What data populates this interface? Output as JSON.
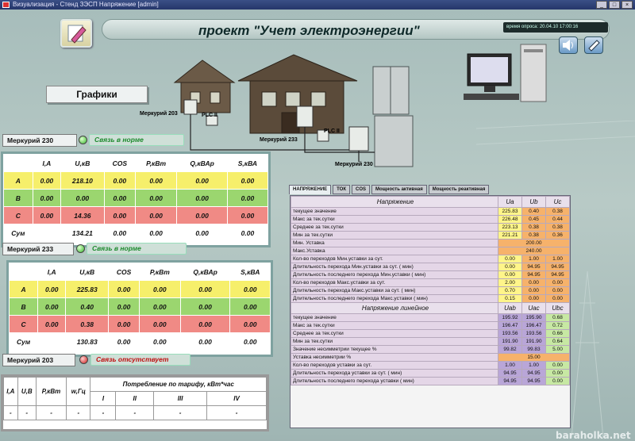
{
  "window": {
    "title": "Визуализация - Стенд ЗЭСП Напряжение [admin]"
  },
  "header": {
    "title": "проект \"Учет электроэнергии\"",
    "poll_time": "время опроса: 20.04.10 17:00:16"
  },
  "nav": {
    "graphs_label": "Графики"
  },
  "scene": {
    "labels": {
      "m203": "Меркурий 203",
      "plc1": "PLC II",
      "m233": "Меркурий 233",
      "plc2": "PLC II",
      "m230": "Меркурий 230"
    }
  },
  "m230": {
    "title": "Меркурий 230",
    "status": "Связь в норме",
    "headers": [
      "",
      "I,A",
      "U,кВ",
      "COS",
      "P,кВт",
      "Q,кВАр",
      "S,кВА"
    ],
    "rows": [
      [
        "A",
        "0.00",
        "218.10",
        "0.00",
        "0.00",
        "0.00",
        "0.00"
      ],
      [
        "B",
        "0.00",
        "0.00",
        "0.00",
        "0.00",
        "0.00",
        "0.00"
      ],
      [
        "C",
        "0.00",
        "14.36",
        "0.00",
        "0.00",
        "0.00",
        "0.00"
      ],
      [
        "Сум",
        "",
        "134.21",
        "0.00",
        "0.00",
        "0.00",
        "0.00"
      ]
    ]
  },
  "m233": {
    "title": "Меркурий 233",
    "status": "Связь в норме",
    "headers": [
      "",
      "I,A",
      "U,кВ",
      "COS",
      "P,кВт",
      "Q,кВАр",
      "S,кВА"
    ],
    "rows": [
      [
        "A",
        "0.00",
        "225.83",
        "0.00",
        "0.00",
        "0.00",
        "0.00"
      ],
      [
        "B",
        "0.00",
        "0.40",
        "0.00",
        "0.00",
        "0.00",
        "0.00"
      ],
      [
        "C",
        "0.00",
        "0.38",
        "0.00",
        "0.00",
        "0.00",
        "0.00"
      ],
      [
        "Сум",
        "",
        "130.83",
        "0.00",
        "0.00",
        "0.00",
        "0.00"
      ]
    ]
  },
  "m203": {
    "title": "Меркурий 203",
    "status": "Связь отсутствует",
    "headers": [
      "I,A",
      "U,B",
      "P,кВт",
      "w,Гц"
    ],
    "consumption_header": "Потребление по тарифу, кВт*час",
    "tariffs": [
      "I",
      "II",
      "III",
      "IV"
    ],
    "values": [
      "-",
      "-",
      "-",
      "-",
      "-",
      "-",
      "-",
      "-"
    ]
  },
  "tabs": [
    "НАПРЯЖЕНИЕ",
    "ТОК",
    "COS",
    "Мощность активная",
    "Мощность реактивная"
  ],
  "voltage": {
    "section1": "Напряжение",
    "cols1": [
      "Ua",
      "Ub",
      "Uc"
    ],
    "rows1": [
      {
        "label": "текущее значение",
        "v": [
          "225.83",
          "0.40",
          "0.38"
        ]
      },
      {
        "label": "Макс за тек.сутки",
        "v": [
          "226.48",
          "0.45",
          "0.44"
        ]
      },
      {
        "label": "Среднее за тек.сутки",
        "v": [
          "223.13",
          "0.38",
          "0.38"
        ]
      },
      {
        "label": "Мин за тек.сутки",
        "v": [
          "221.21",
          "0.38",
          "0.36"
        ]
      },
      {
        "label": "Мин. Уставка",
        "merged": "200.00"
      },
      {
        "label": "Макс.Уставка",
        "merged": "240.00"
      },
      {
        "label": "Кол-во переходов Мин.уставки за сут.",
        "v": [
          "0.00",
          "1.00",
          "1.00"
        ]
      },
      {
        "label": "Длительность перехода Мин.уставки за сут. ( мин)",
        "v": [
          "0.00",
          "94.95",
          "94.95"
        ]
      },
      {
        "label": "Длительность последнего перехода Мин.уставки ( мин)",
        "v": [
          "0.00",
          "94.95",
          "94.95"
        ]
      },
      {
        "label": "Кол-во переходов Макс.уставки за сут.",
        "v": [
          "2.00",
          "0.00",
          "0.00"
        ]
      },
      {
        "label": "Длительность перехода Макс.уставки за сут. ( мин)",
        "v": [
          "0.70",
          "0.00",
          "0.00"
        ]
      },
      {
        "label": "Длительность последнего перехода Макс.уставки ( мин)",
        "v": [
          "0.15",
          "0.00",
          "0.00"
        ]
      }
    ],
    "section2": "Напряжение линейное",
    "cols2": [
      "Uab",
      "Uac",
      "Ubc"
    ],
    "rows2": [
      {
        "label": "текущее значение",
        "v": [
          "195.92",
          "195.90",
          "0.68"
        ]
      },
      {
        "label": "Макс за тек.сутки",
        "v": [
          "196.47",
          "196.47",
          "0.72"
        ]
      },
      {
        "label": "Среднее за тек.сутки",
        "v": [
          "193.56",
          "193.56",
          "0.66"
        ]
      },
      {
        "label": "Мин за тек.сутки",
        "v": [
          "191.90",
          "191.90",
          "0.64"
        ]
      },
      {
        "label": "Значение несимметрии текущее  %",
        "v": [
          "99.82",
          "99.83",
          "5.00"
        ]
      },
      {
        "label": "Уставка несимметрии %",
        "merged": "15.00"
      },
      {
        "label": "Кол-во переходов уставки за сут.",
        "v": [
          "1.00",
          "1.00",
          "0.00"
        ]
      },
      {
        "label": "Длительность перехода уставки за сут. ( мин)",
        "v": [
          "94.95",
          "94.95",
          "0.00"
        ]
      },
      {
        "label": "Длительность последнего перехода уставки ( мин)",
        "v": [
          "94.95",
          "94.95",
          "0.00"
        ]
      }
    ]
  },
  "watermark": "baraholka.net",
  "colors": {
    "phase_a": "#f6ef6b",
    "phase_b": "#9bd66f",
    "phase_c": "#f08a85",
    "status_ok": "#1d8a2d",
    "status_bad": "#c01010"
  }
}
